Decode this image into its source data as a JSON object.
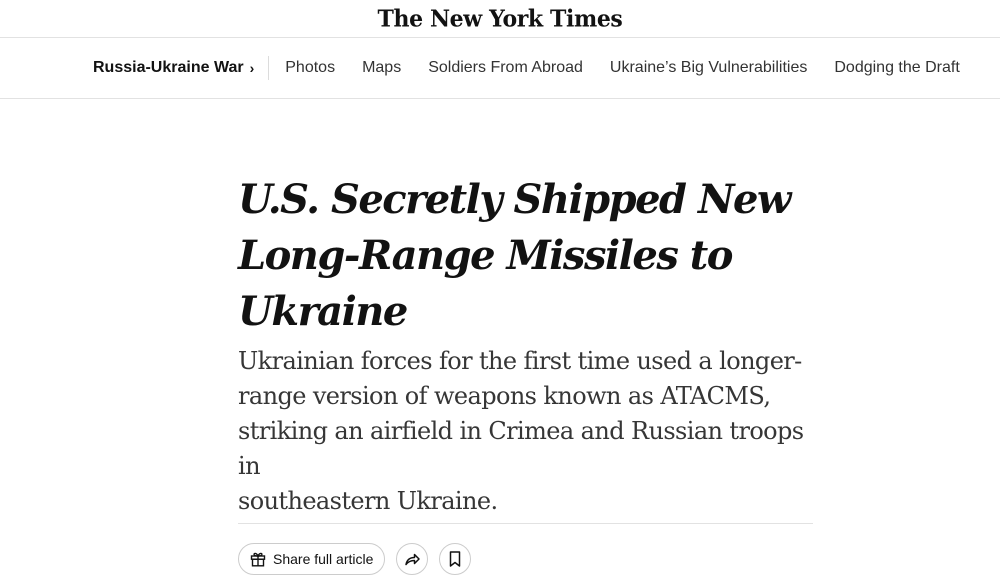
{
  "masthead": {
    "logo_text": "The New York Times"
  },
  "nav": {
    "section_label": "Russia-Ukraine War",
    "section_chevron": "›",
    "links": [
      "Photos",
      "Maps",
      "Soldiers From Abroad",
      "Ukraine’s Big Vulnerabilities",
      "Dodging the Draft"
    ]
  },
  "article": {
    "headline_lines": [
      "U.S. Secretly Shipped New",
      "Long-Range Missiles to",
      "Ukraine"
    ],
    "summary_lines": [
      "Ukrainian forces for the first time used a longer-",
      "range version of weapons known as ATACMS,",
      "striking an airfield in Crimea and Russian troops in",
      "southeastern Ukraine."
    ]
  },
  "toolbar": {
    "share_label": "Share full article",
    "icons": {
      "gift": "gift-icon",
      "share": "share-arrow-icon",
      "bookmark": "bookmark-icon"
    }
  },
  "colors": {
    "text": "#121212",
    "summary_text": "#363636",
    "nav_text": "#333333",
    "rule": "#e2e2e2",
    "button_border": "#cccccc"
  }
}
